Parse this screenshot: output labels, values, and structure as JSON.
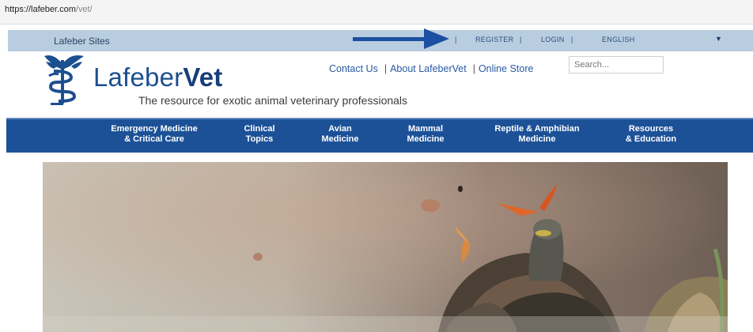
{
  "browser": {
    "url_host": "https://lafeber.com",
    "url_path": "/vet/"
  },
  "sites_bar": {
    "label": "Lafeber Sites",
    "separator": "|",
    "register": "REGISTER",
    "login": "LOGIN",
    "language": "ENGLISH",
    "dropdown": "▼"
  },
  "header": {
    "logo_light": "Lafeber",
    "logo_bold": "Vet",
    "tagline": "The resource for exotic animal veterinary professionals",
    "links": [
      "Contact Us",
      "About LafeberVet",
      "Online Store"
    ],
    "search_placeholder": "Search..."
  },
  "nav": [
    {
      "label": "Emergency Medicine\n& Critical Care"
    },
    {
      "label": "Clinical\nTopics"
    },
    {
      "label": "Avian\nMedicine"
    },
    {
      "label": "Mammal\nMedicine"
    },
    {
      "label": "Reptile & Amphibian\nMedicine"
    },
    {
      "label": "Resources\n& Education"
    }
  ],
  "colors": {
    "nav_bg": "#1c5197",
    "sites_bg": "#b9cde0",
    "brand": "#1b4f8f",
    "arrow": "#1c4fa3"
  },
  "icons": [
    "caduceus-logo-icon",
    "arrow-right-icon",
    "chevron-down-icon"
  ]
}
